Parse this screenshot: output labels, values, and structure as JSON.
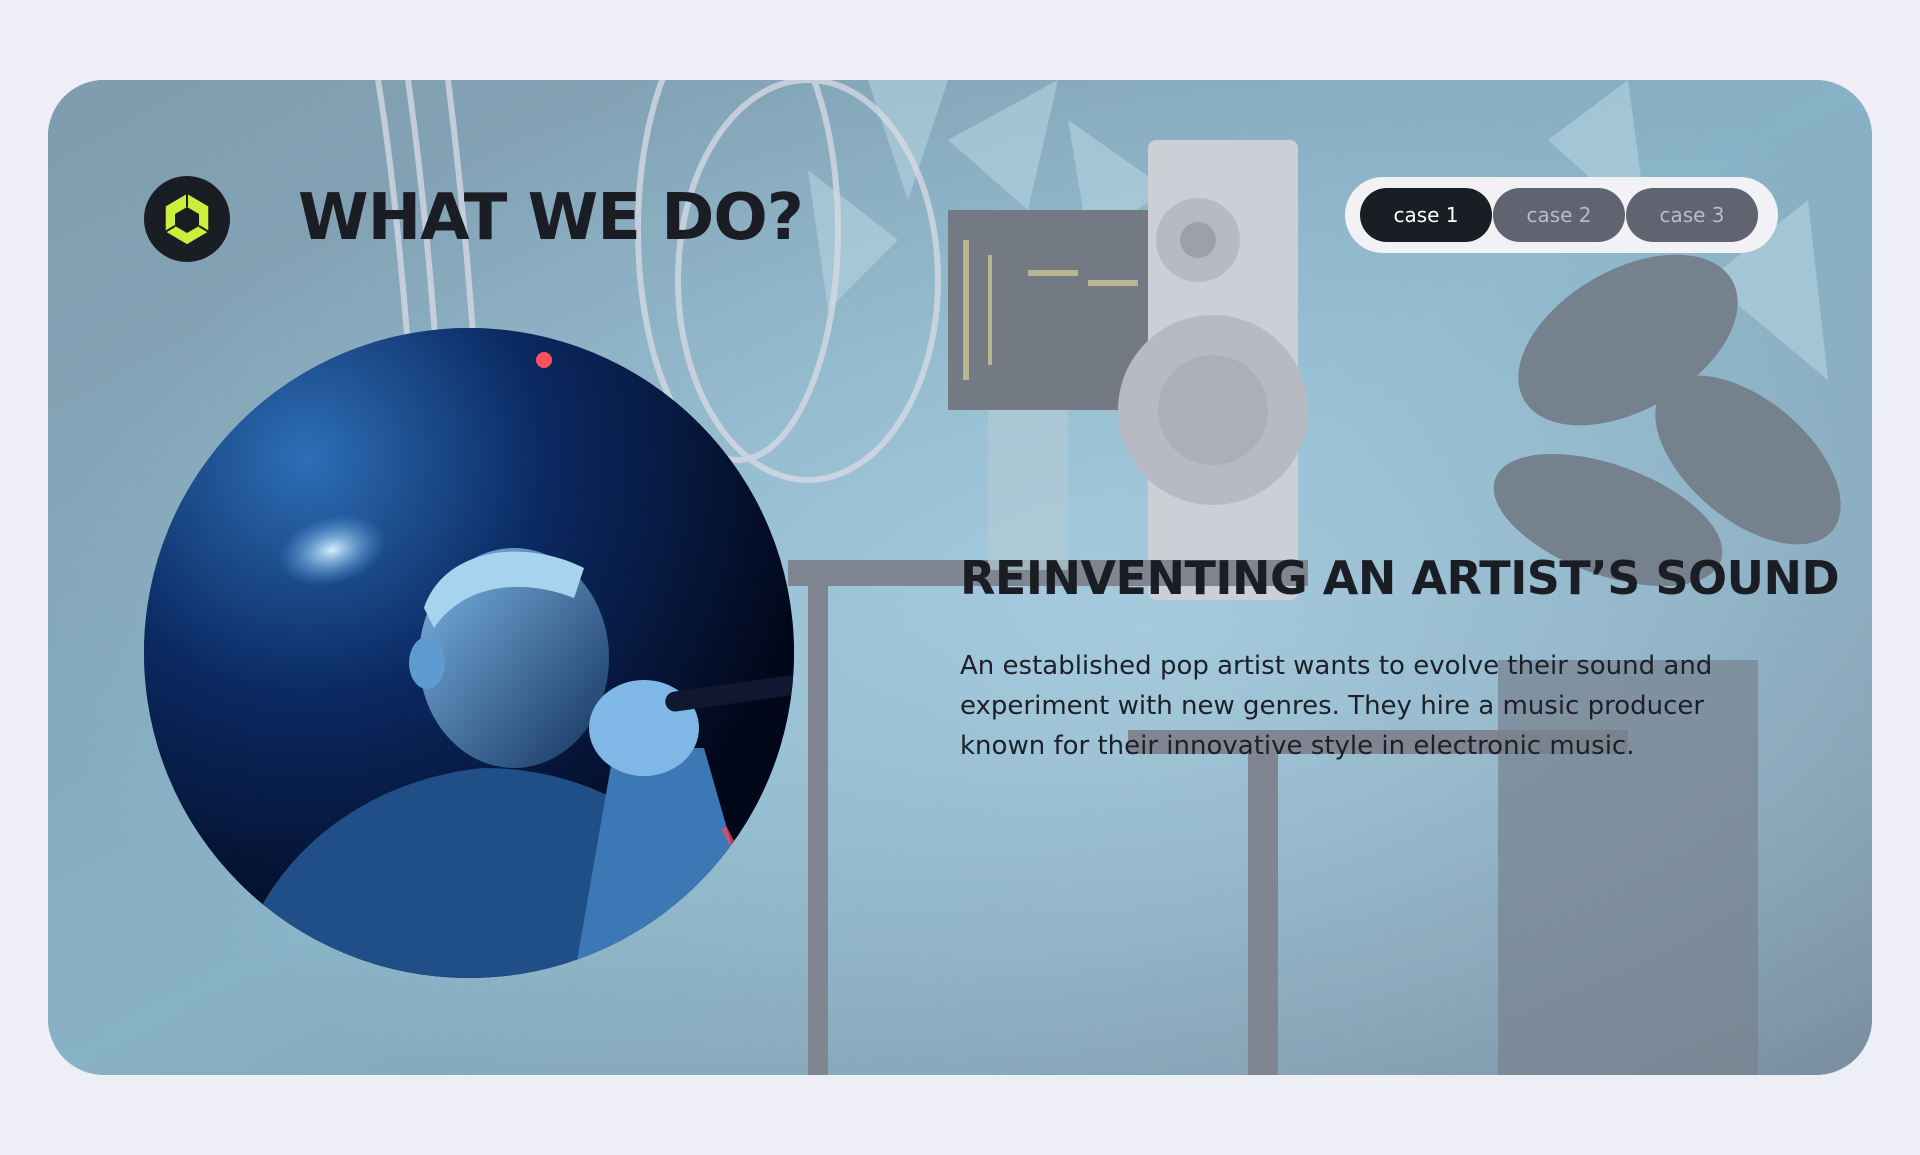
{
  "section": {
    "title": "WHAT WE DO?"
  },
  "logo": {
    "icon": "hexagon-ring-logo",
    "accent_color": "#c8f03c",
    "background_color": "#1b1d24"
  },
  "case_switch": {
    "items": [
      {
        "label": "case 1",
        "active": true
      },
      {
        "label": "case 2",
        "active": false
      },
      {
        "label": "case 3",
        "active": false
      }
    ]
  },
  "case": {
    "heading": "REINVENTING AN ARTIST’S SOUND",
    "body": "An established pop artist wants to evolve their sound and experiment with new genres. They hire a music producer known for their innovative style in electronic music."
  },
  "images": {
    "background": "music-studio-photo",
    "portrait": "singer-with-microphone-photo"
  },
  "colors": {
    "page_background": "#eeeff6",
    "dark": "#1b1d24",
    "inactive_tab": "#616470"
  }
}
